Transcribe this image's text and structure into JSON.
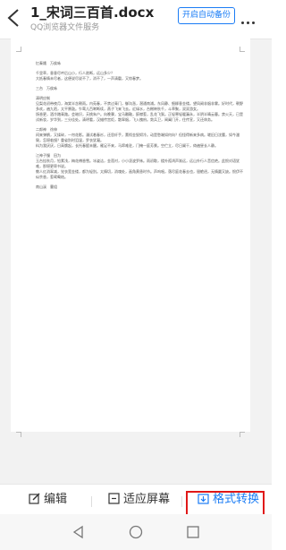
{
  "header": {
    "title": "1_宋词三百首.docx",
    "subtitle": "QQ浏览器文件服务",
    "auto_backup_label": "开启自动备份"
  },
  "document": {
    "lines": [
      [
        "忆秦娥　万俟咏"
      ],
      [
        "千里草，垂垂尽吟后山小，行人欲断，远山多少？",
        "大抵春情未尽者，这便说尽说不了，消不了，一声清磬，又惊春梦。"
      ],
      [
        "三台　万俟咏"
      ],
      [
        "清明应制",
        "见梨花初带夜月，海棠半含朝雨。内苑春，不禁过青门，御沟涨，潜通南浦。东风静、细柳垂金缕。望凤阙非烟非雾。好时代，朝野多欢，遍九陌，太平箫鼓。乍莺儿百啭断续，燕子飞来飞去。近绿水，台榭映秋千，斗草聚，双双游女。",
        "饧香更，酒冷踏青路。会暗识，夭桃朱户。向晚骤，宝马雕鞍，醉襟惹，乱花飞絮。正轻寒轻暖漏永，半阴半晴云暮。禁火天，已是试新妆，岁华到，三分佳处。清明看，汉蜡传宫炬，散翠烟，飞入槐府。敛兵卫，阊阖门开，住传宣，又还休务。"
      ],
      [
        "二郎神　徐伸",
        "闷来弹鹊，又揉碎，一帘花影。漫试着春衫，还思纤手，薰彻金猊烬冷。动是愁端如何向？但怪得新来多病。嗟旧日沈腰，如今潘鬓，怎堪临镜？重省别时泪湿，罗衣犹凝。",
        "料为我厌厌，日高慵起，长托春酲未醒。雁足不来，马蹄难驻，门掩一庭芳景。空伫立，尽日阑干，倚遍昼长人静。"
      ],
      [
        "江神子慢　田为",
        "玉台挂秋月，铅素浅，梅花傅香雪。冰姿洁，金莲衬，小小凌波罗袜。雨初歇，楼外孤鸿声渐远，远山外行人音信绝。此恨对语犹难，那堪更寄书说。",
        "教人红消翠减，觉衣宽金缕，都为轻别。太情切，消魂处，画角黄昏时节。声呜咽，落尽庭花春去也，银蟾迥，无情圆又缺。恨伊不似余香，惹鸳鸯结。"
      ],
      [
        "南山溪　曹组"
      ]
    ]
  },
  "toolbar": {
    "edit_label": "编辑",
    "fit_label": "适应屏幕",
    "convert_label": "格式转换"
  }
}
